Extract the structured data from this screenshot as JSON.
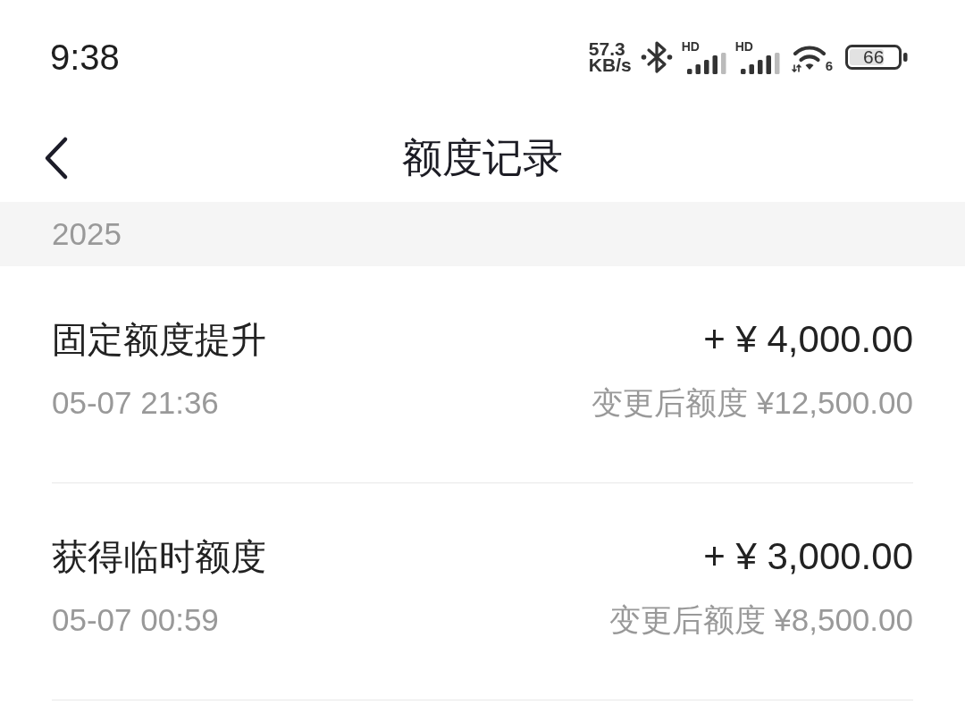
{
  "status_bar": {
    "time": "9:38",
    "net_speed": {
      "value": "57.3",
      "unit": "KB/s"
    },
    "cellular": [
      {
        "label": "HD"
      },
      {
        "label": "HD"
      }
    ],
    "wifi": {
      "label": "6"
    },
    "battery": {
      "label": "66"
    }
  },
  "header": {
    "title": "额度记录"
  },
  "sections": [
    {
      "year": "2025",
      "records": [
        {
          "title": "固定额度提升",
          "amount": "+ ¥ 4,000.00",
          "time": "05-07 21:36",
          "balance_after": "变更后额度 ¥12,500.00"
        },
        {
          "title": "获得临时额度",
          "amount": "+ ¥ 3,000.00",
          "time": "05-07 00:59",
          "balance_after": "变更后额度 ¥8,500.00"
        }
      ]
    }
  ]
}
